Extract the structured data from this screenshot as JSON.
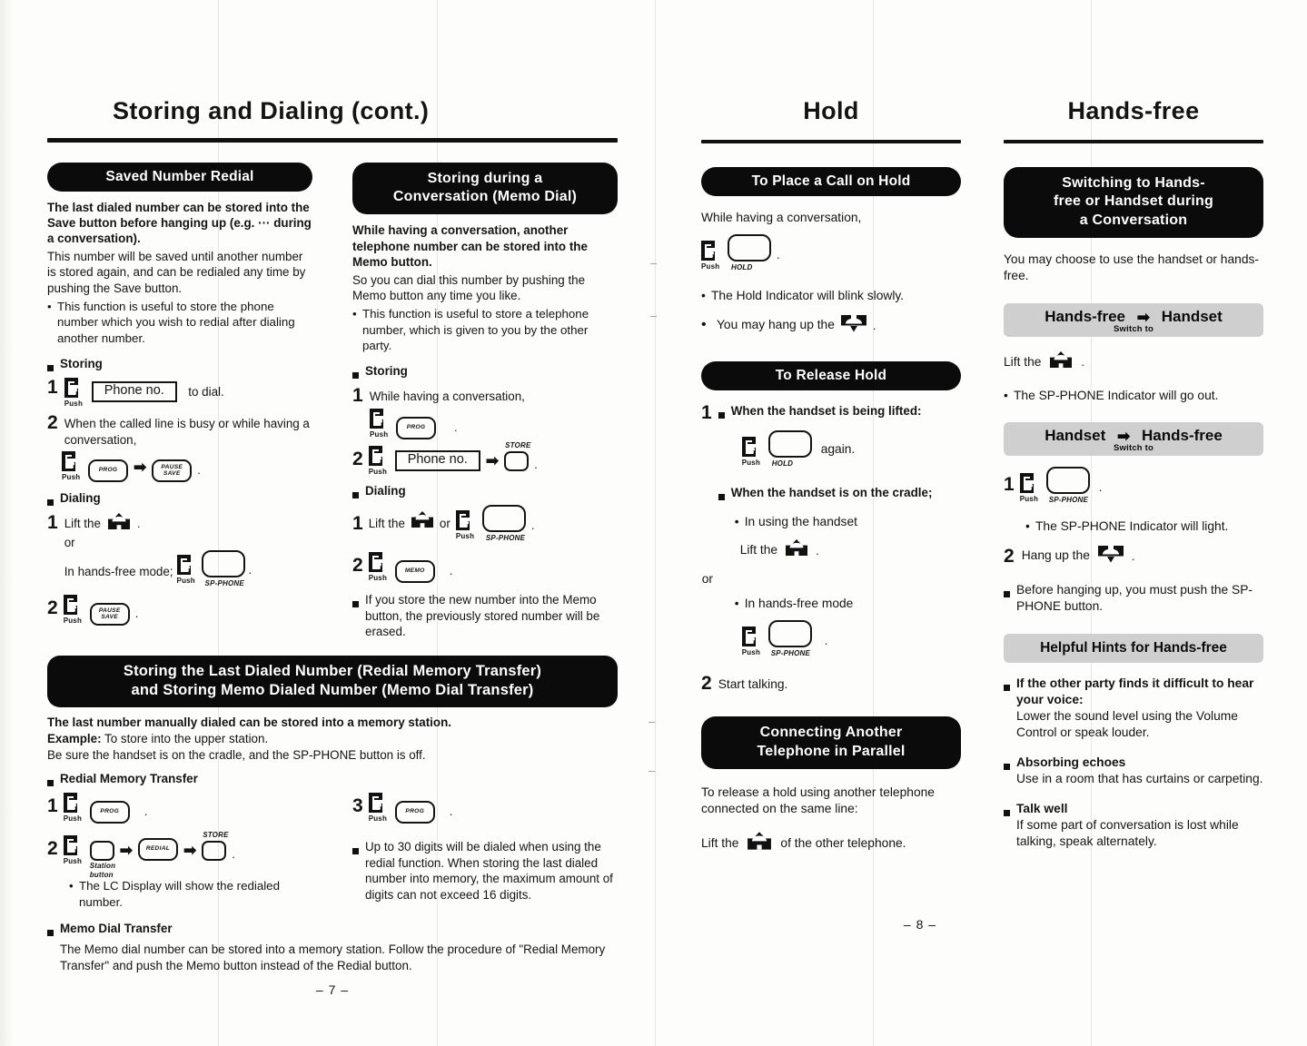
{
  "page_left": {
    "title": "Storing and Dialing (cont.)",
    "page_number": "– 7 –",
    "col1": {
      "banner": "Saved Number Redial",
      "intro_bold": "The last dialed number can be stored into the Save button before hanging up (e.g. ··· during a conversation).",
      "intro_plain": "This number will be saved until another number is stored again, and can be redialed any time by pushing the Save button.",
      "bullet1": "This function is useful to store the phone number which you wish to redial after dialing another number.",
      "storing_label": "Storing",
      "s1_push": "Push",
      "s1_phoneno": "Phone no.",
      "s1_tail": "to dial.",
      "s2_text": "When the called line is busy or while having a conversation,",
      "s2_push": "Push",
      "s2_btn1": "PROG",
      "s2_btn2_l1": "PAUSE",
      "s2_btn2_l2": "SAVE",
      "dialing_label": "Dialing",
      "d1_lift": "Lift the",
      "d1_or": "or",
      "d1_handsfree": "In hands-free mode;",
      "d1_push": "Push",
      "d1_spphone": "SP-PHONE",
      "d2_push": "Push",
      "d2_btn_l1": "PAUSE",
      "d2_btn_l2": "SAVE"
    },
    "col2": {
      "banner_l1": "Storing during a",
      "banner_l2": "Conversation (Memo Dial)",
      "intro_bold": "While having a conversation, another telephone number can be stored into the Memo button.",
      "intro_plain": "So you can dial this number by pushing the Memo button any time you like.",
      "bullet1": "This function is useful to store a telephone number, which is given to you by the other party.",
      "storing_label": "Storing",
      "s1_text": "While having a conversation,",
      "s1_push": "Push",
      "s1_btn": "PROG",
      "s2_push": "Push",
      "s2_phoneno": "Phone no.",
      "s2_store": "STORE",
      "dialing_label": "Dialing",
      "d1_lift": "Lift the",
      "d1_or": "or",
      "d1_push": "Push",
      "d1_spphone": "SP-PHONE",
      "d2_push": "Push",
      "d2_btn": "MEMO",
      "note": "If you store the new number into the Memo button, the previously stored number will be erased."
    },
    "transfer": {
      "banner_l1": "Storing the Last Dialed Number (Redial Memory Transfer)",
      "banner_l2": "and Storing Memo Dialed Number (Memo Dial Transfer)",
      "line_bold": "The last number manually dialed can be stored into a memory station.",
      "example_label": "Example:",
      "example_text": "To store into the upper station.",
      "line_plain": "Be sure the handset is on the cradle, and the SP-PHONE button is off.",
      "rmt_label": "Redial Memory Transfer",
      "r1_push": "Push",
      "r1_btn": "PROG",
      "r3_push": "Push",
      "r3_btn": "PROG",
      "r2_push": "Push",
      "r2_station_l1": "Station",
      "r2_station_l2": "button",
      "r2_btn_redial": "REDIAL",
      "r2_store": "STORE",
      "r2_bullet": "The LC Display will show the redialed number.",
      "right_note": "Up to 30 digits will be dialed when using the redial function. When storing the last dialed number into memory, the maximum amount of digits can not exceed 16 digits.",
      "mdt_label": "Memo Dial Transfer",
      "mdt_text": "The Memo dial number can be stored into a memory station. Follow the procedure of \"Redial Memory Transfer\" and push the Memo button instead of the Redial button."
    }
  },
  "page_right": {
    "page_number": "– 8 –",
    "hold": {
      "title": "Hold",
      "banner1": "To Place a Call on Hold",
      "p1": "While having a conversation,",
      "p1_push": "Push",
      "p1_hold": "HOLD",
      "bullet1": "The Hold Indicator will blink slowly.",
      "bullet2_pre": "You may hang up the",
      "banner2": "To Release Hold",
      "r1_head": "When the handset is being lifted:",
      "r1_push": "Push",
      "r1_hold": "HOLD",
      "r1_again": "again.",
      "r2_head": "When the handset is on the cradle;",
      "r2_dot1": "In using the handset",
      "r2_lift": "Lift the",
      "r2_or": "or",
      "r2_dot2": "In hands-free mode",
      "r2_push": "Push",
      "r2_spphone": "SP-PHONE",
      "step2": "Start talking.",
      "banner3_l1": "Connecting Another",
      "banner3_l2": "Telephone in Parallel",
      "p3": "To release a hold using another telephone connected on the same line:",
      "p3_lift": "Lift the",
      "p3_tail": "of the other telephone."
    },
    "handsfree": {
      "title": "Hands-free",
      "banner_l1": "Switching to Hands-",
      "banner_l2": "free or Handset during",
      "banner_l3": "a Conversation",
      "intro": "You may choose to use the handset or hands-free.",
      "band1_left": "Hands-free",
      "band1_right": "Handset",
      "band1_sub": "Switch to",
      "b1_lift": "Lift the",
      "b1_bullet": "The SP-PHONE Indicator will go out.",
      "band2_left": "Handset",
      "band2_right": "Hands-free",
      "band2_sub": "Switch to",
      "b2_push": "Push",
      "b2_spphone": "SP-PHONE",
      "b2_bullet": "The SP-PHONE Indicator will light.",
      "b2_step2": "Hang up the",
      "b2_note": "Before hanging up, you must push the SP-PHONE button.",
      "hints_band": "Helpful Hints for Hands-free",
      "hint1_head": "If the other party finds it difficult to hear your voice:",
      "hint1_body": "Lower the sound level using the Volume Control or speak louder.",
      "hint2_head": "Absorbing echoes",
      "hint2_body": "Use in a room that has curtains or carpeting.",
      "hint3_head": "Talk well",
      "hint3_body": "If some part of conversation is lost while talking, speak alternately."
    }
  }
}
